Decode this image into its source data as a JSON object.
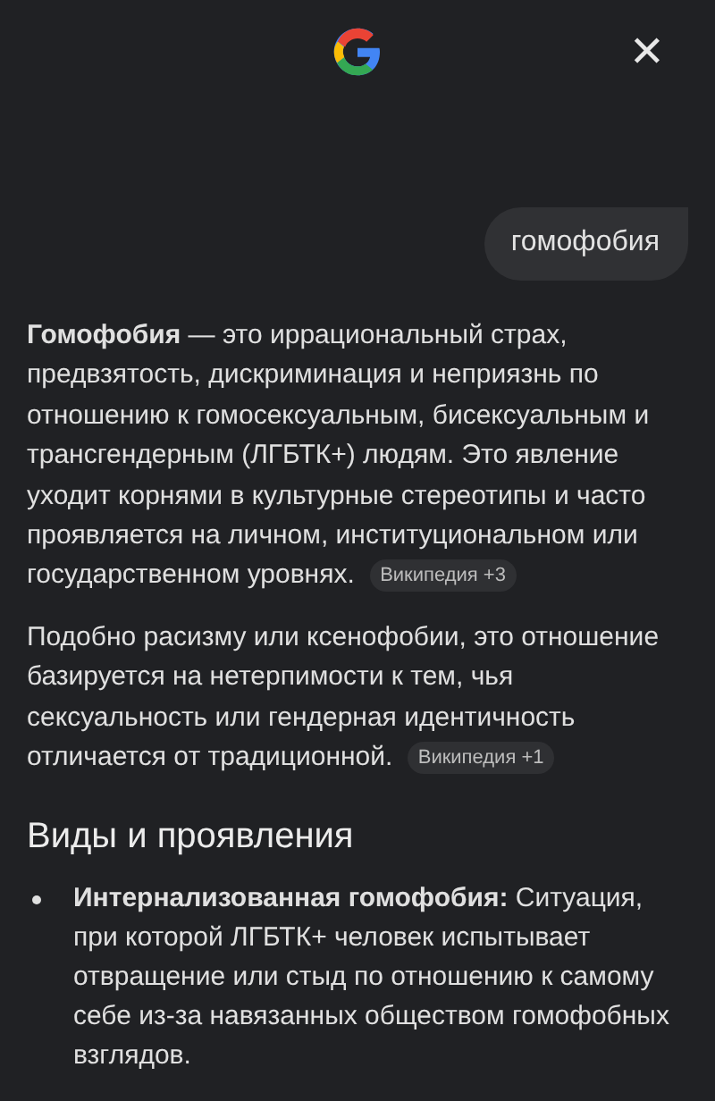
{
  "header": {
    "close": "✕"
  },
  "query": "гомофобия",
  "paragraphs": [
    {
      "text": "**Гомофобия** — это иррациональный страх, предвзятость, дискриминация и неприязнь по отношению к гомосексуальным, бисексуальным и трансгендерным (ЛГБТК+) людям. Это явление уходит корнями в культурные стереотипы и часто проявляется на личном, институциональном или государственном уровнях.",
      "source": "Википедия +3"
    },
    {
      "text": "Подобно расизму или ксенофобии, это отношение базируется на нетерпимости к тем, чья сексуальность или гендерная идентичность отличается от традиционной.",
      "source": "Википедия +1"
    }
  ],
  "section": {
    "heading": "Виды и проявления",
    "bullets": [
      "**Интернализованная гомофобия:** Ситуация, при которой ЛГБТК+ человек испытывает отвращение или стыд по отношению к самому себе из-за навязанных обществом гомофобных взглядов."
    ]
  }
}
